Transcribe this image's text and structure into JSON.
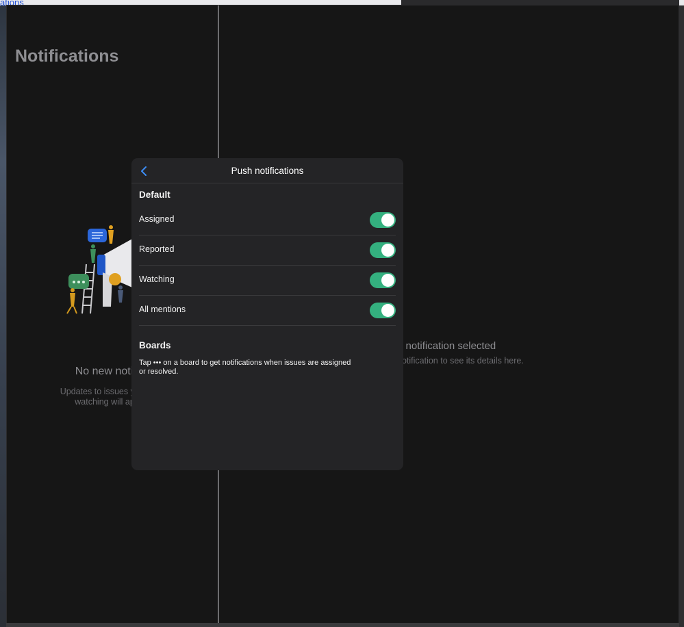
{
  "background": {
    "link_text": "ations"
  },
  "notifications_pane": {
    "title": "Notifications",
    "empty_title": "No new notific",
    "empty_subtitle_line1": "Updates to issues you are",
    "empty_subtitle_line2": "watching will appe"
  },
  "detail_pane": {
    "empty_title": "o notification selected",
    "empty_subtitle": "notification to see its details here."
  },
  "modal": {
    "title": "Push notifications",
    "default_label": "Default",
    "rows": [
      {
        "label": "Assigned",
        "enabled": true
      },
      {
        "label": "Reported",
        "enabled": true
      },
      {
        "label": "Watching",
        "enabled": true
      },
      {
        "label": "All mentions",
        "enabled": true
      }
    ],
    "boards_label": "Boards",
    "boards_text_line1": "Tap ••• on a board to get notifications when issues are assigned",
    "boards_text_line2": "or resolved."
  },
  "icons": {
    "back": "chevron-left-icon",
    "illustration": "megaphone-illustration"
  },
  "colors": {
    "toggle_on": "#34b07f",
    "accent": "#3d8ef7",
    "app_background": "#161616",
    "modal_background": "#242426"
  }
}
